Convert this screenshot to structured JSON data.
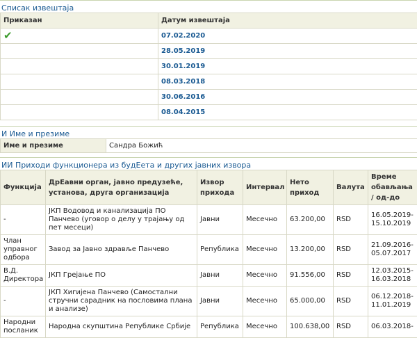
{
  "reports_section": {
    "title": "Списак извештаја",
    "col_shown": "Приказан",
    "col_date": "Датум извештаја",
    "rows": [
      {
        "shown": true,
        "date": "07.02.2020"
      },
      {
        "shown": false,
        "date": "28.05.2019"
      },
      {
        "shown": false,
        "date": "30.01.2019"
      },
      {
        "shown": false,
        "date": "08.03.2018"
      },
      {
        "shown": false,
        "date": "30.06.2016"
      },
      {
        "shown": false,
        "date": "08.04.2015"
      }
    ],
    "check_icon": "checkmark-icon",
    "check_color": "#3a9a2a"
  },
  "name_section": {
    "title": "И Име и презиме",
    "label": "Име и презиме",
    "value": "Сандра Божић"
  },
  "income_section": {
    "title": "ИИ Приходи функционера из будЕета и других јавних извора",
    "headers": {
      "function": "Функција",
      "organ": "ДрЕавни орган, јавно предузеће, установа, друга организација",
      "source": "Извор прихода",
      "interval": "Интервал",
      "net": "Нето приход",
      "currency": "Валута",
      "period": "Време обављања / од-до"
    },
    "rows": [
      {
        "function": "-",
        "organ": "ЈКП Водовод и канализација ПО Панчево (уговор о делу у трајању од пет месеци)",
        "source": "Јавни",
        "interval": "Месечно",
        "net": "63.200,00",
        "currency": "RSD",
        "period": "16.05.2019-15.10.2019"
      },
      {
        "function": "Члан управног одбора",
        "organ": "Завод за Јавно здравље Панчево",
        "source": "Република",
        "interval": "Месечно",
        "net": "13.200,00",
        "currency": "RSD",
        "period": "21.09.2016-05.07.2017"
      },
      {
        "function": "В.Д. Директора",
        "organ": "ЈКП Грејање ПО",
        "source": "Јавни",
        "interval": "Месечно",
        "net": "91.556,00",
        "currency": "RSD",
        "period": "12.03.2015-16.03.2018"
      },
      {
        "function": "-",
        "organ": "ЈКП Хигијена Панчево (Самостални стручни сарадник на пословима плана и анализе)",
        "source": "Јавни",
        "interval": "Месечно",
        "net": "65.000,00",
        "currency": "RSD",
        "period": "06.12.2018-11.01.2019"
      },
      {
        "function": "Народни посланик",
        "organ": "Народна скупштина Републике Србије",
        "source": "Република",
        "interval": "Месечно",
        "net": "100.638,00",
        "currency": "RSD",
        "period": "06.03.2018-"
      }
    ]
  },
  "colors": {
    "title": "#1a5a92",
    "header_bg": "#f1f1e2",
    "border": "#d8d8c6"
  }
}
